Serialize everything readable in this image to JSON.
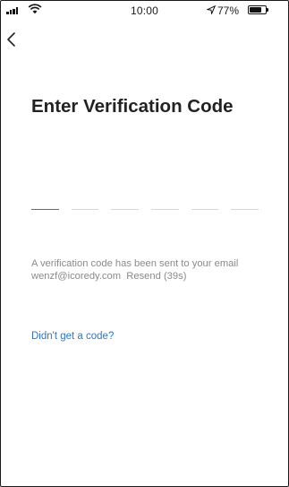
{
  "status_bar": {
    "time": "10:00",
    "battery_percent": "77%",
    "battery_level": 0.77
  },
  "header": {
    "back_icon": "chevron-left-icon"
  },
  "main": {
    "title": "Enter Verification Code",
    "code_length": 6,
    "active_slot": 1,
    "info_text": "A verification code has been sent to your email wenzf@icoredy.com",
    "resend_label": "Resend (39s)",
    "help_link": "Didn't get a code?"
  },
  "colors": {
    "accent": "#2f77c3",
    "muted_text": "#8a8a8a",
    "slot_line": "#d6d6d6"
  }
}
